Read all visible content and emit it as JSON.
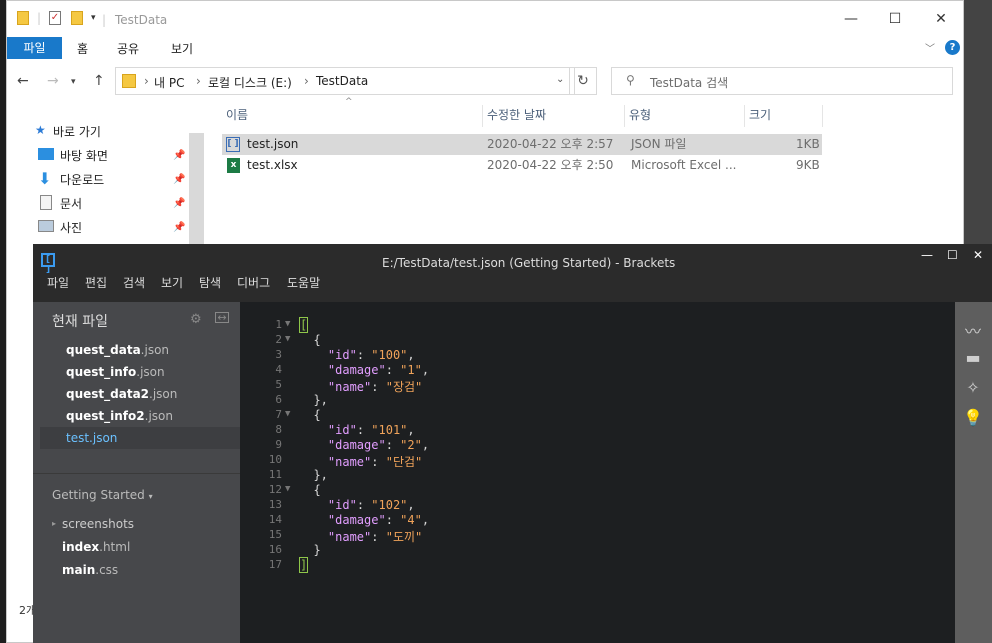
{
  "explorer": {
    "title": "TestData",
    "ribbon_tabs": [
      "파일",
      "홈",
      "공유",
      "보기"
    ],
    "breadcrumb": [
      "내 PC",
      "로컬 디스크 (E:)",
      "TestData"
    ],
    "search_placeholder": "TestData 검색",
    "columns": [
      "이름",
      "수정한 날짜",
      "유형",
      "크기"
    ],
    "files": [
      {
        "name": "test.json",
        "date": "2020-04-22 오후 2:57",
        "type": "JSON 파일",
        "size": "1KB"
      },
      {
        "name": "test.xlsx",
        "date": "2020-04-22 오후 2:50",
        "type": "Microsoft Excel ...",
        "size": "9KB"
      }
    ],
    "quick_access": {
      "header": "바로 가기",
      "items": [
        "바탕 화면",
        "다운로드",
        "문서",
        "사진"
      ]
    },
    "status_count": "2개"
  },
  "brackets": {
    "title": "E:/TestData/test.json (Getting Started) - Brackets",
    "menu": [
      "파일",
      "편집",
      "검색",
      "보기",
      "탐색",
      "디버그",
      "도움말"
    ],
    "working_files_header": "현재 파일",
    "working_files": [
      {
        "base": "quest_data",
        "ext": ".json"
      },
      {
        "base": "quest_info",
        "ext": ".json"
      },
      {
        "base": "quest_data2",
        "ext": ".json"
      },
      {
        "base": "quest_info2",
        "ext": ".json"
      },
      {
        "base": "test",
        "ext": ".json"
      }
    ],
    "project_name": "Getting Started",
    "project_items": [
      {
        "label": "screenshots",
        "type": "folder"
      },
      {
        "base": "index",
        "ext": ".html",
        "type": "file"
      },
      {
        "base": "main",
        "ext": ".css",
        "type": "file"
      }
    ],
    "line_numbers": [
      "1",
      "2",
      "3",
      "4",
      "5",
      "6",
      "7",
      "8",
      "9",
      "10",
      "11",
      "12",
      "13",
      "14",
      "15",
      "16",
      "17"
    ],
    "code_lines": [
      {
        "tokens": [
          {
            "c": "br",
            "t": "["
          }
        ]
      },
      {
        "tokens": [
          {
            "c": "p",
            "t": "  {"
          }
        ]
      },
      {
        "tokens": [
          {
            "c": "p",
            "t": "    "
          },
          {
            "c": "k",
            "t": "\"id\""
          },
          {
            "c": "p",
            "t": ": "
          },
          {
            "c": "s",
            "t": "\"100\""
          },
          {
            "c": "p",
            "t": ","
          }
        ]
      },
      {
        "tokens": [
          {
            "c": "p",
            "t": "    "
          },
          {
            "c": "k",
            "t": "\"damage\""
          },
          {
            "c": "p",
            "t": ": "
          },
          {
            "c": "s",
            "t": "\"1\""
          },
          {
            "c": "p",
            "t": ","
          }
        ]
      },
      {
        "tokens": [
          {
            "c": "p",
            "t": "    "
          },
          {
            "c": "k",
            "t": "\"name\""
          },
          {
            "c": "p",
            "t": ": "
          },
          {
            "c": "s",
            "t": "\"장검\""
          }
        ]
      },
      {
        "tokens": [
          {
            "c": "p",
            "t": "  },"
          }
        ]
      },
      {
        "tokens": [
          {
            "c": "p",
            "t": "  {"
          }
        ]
      },
      {
        "tokens": [
          {
            "c": "p",
            "t": "    "
          },
          {
            "c": "k",
            "t": "\"id\""
          },
          {
            "c": "p",
            "t": ": "
          },
          {
            "c": "s",
            "t": "\"101\""
          },
          {
            "c": "p",
            "t": ","
          }
        ]
      },
      {
        "tokens": [
          {
            "c": "p",
            "t": "    "
          },
          {
            "c": "k",
            "t": "\"damage\""
          },
          {
            "c": "p",
            "t": ": "
          },
          {
            "c": "s",
            "t": "\"2\""
          },
          {
            "c": "p",
            "t": ","
          }
        ]
      },
      {
        "tokens": [
          {
            "c": "p",
            "t": "    "
          },
          {
            "c": "k",
            "t": "\"name\""
          },
          {
            "c": "p",
            "t": ": "
          },
          {
            "c": "s",
            "t": "\"단검\""
          }
        ]
      },
      {
        "tokens": [
          {
            "c": "p",
            "t": "  },"
          }
        ]
      },
      {
        "tokens": [
          {
            "c": "p",
            "t": "  {"
          }
        ]
      },
      {
        "tokens": [
          {
            "c": "p",
            "t": "    "
          },
          {
            "c": "k",
            "t": "\"id\""
          },
          {
            "c": "p",
            "t": ": "
          },
          {
            "c": "s",
            "t": "\"102\""
          },
          {
            "c": "p",
            "t": ","
          }
        ]
      },
      {
        "tokens": [
          {
            "c": "p",
            "t": "    "
          },
          {
            "c": "k",
            "t": "\"damage\""
          },
          {
            "c": "p",
            "t": ": "
          },
          {
            "c": "s",
            "t": "\"4\""
          },
          {
            "c": "p",
            "t": ","
          }
        ]
      },
      {
        "tokens": [
          {
            "c": "p",
            "t": "    "
          },
          {
            "c": "k",
            "t": "\"name\""
          },
          {
            "c": "p",
            "t": ": "
          },
          {
            "c": "s",
            "t": "\"도끼\""
          }
        ]
      },
      {
        "tokens": [
          {
            "c": "p",
            "t": "  }"
          }
        ]
      },
      {
        "tokens": [
          {
            "c": "br",
            "t": "]"
          }
        ]
      }
    ],
    "colors": {
      "key": "#e29eff",
      "string": "#f0a35a",
      "bracket": "#8fc74a",
      "selected_file": "#6bc1ff"
    }
  }
}
